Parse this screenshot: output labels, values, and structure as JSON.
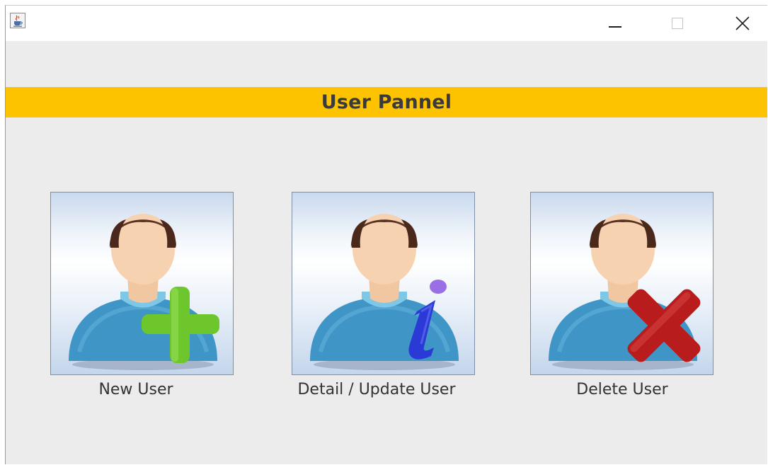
{
  "window": {
    "banner_title": "User Pannel",
    "app_icon": "java-cup-icon",
    "controls": {
      "minimize_icon": "minimize-icon",
      "maximize_icon": "maximize-icon",
      "close_icon": "close-icon"
    }
  },
  "actions": [
    {
      "label": "New User",
      "icon": "user-add-icon",
      "badge": "green-plus"
    },
    {
      "label": "Detail / Update User",
      "icon": "user-info-icon",
      "badge": "blue-info"
    },
    {
      "label": "Delete User",
      "icon": "user-delete-icon",
      "badge": "red-x"
    }
  ],
  "colors": {
    "banner": "#fdc300",
    "background": "#ececec",
    "titlebar": "#ffffff"
  }
}
